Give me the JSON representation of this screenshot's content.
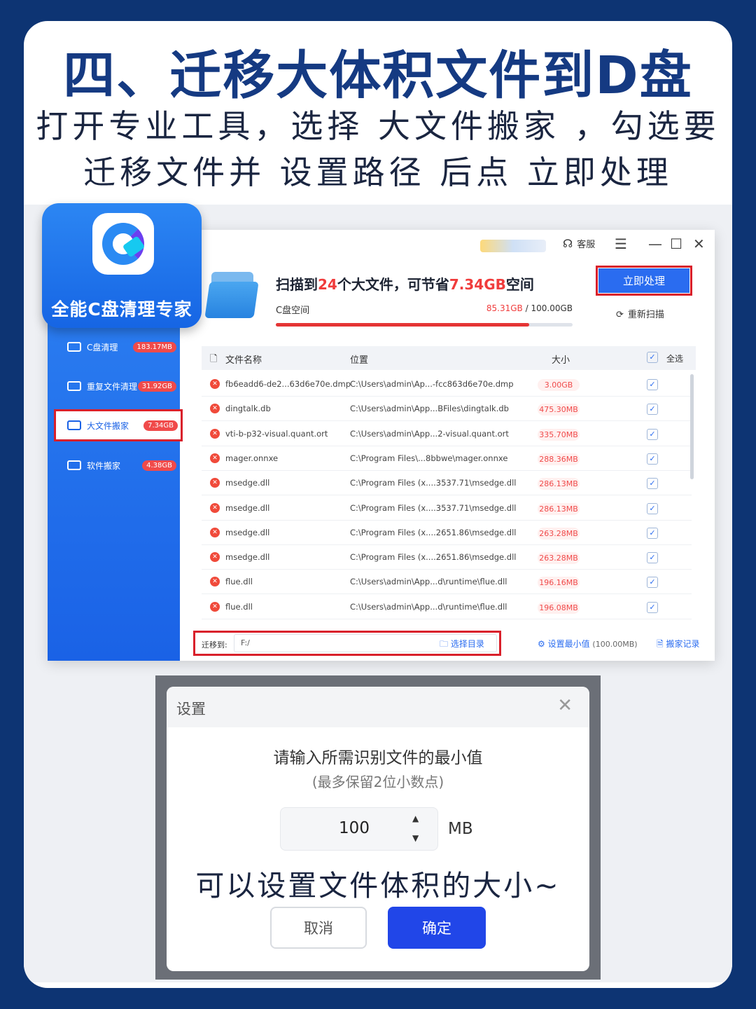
{
  "headline": "四、迁移大体积文件到D盘",
  "subtitle_line1": "打开专业工具，选择 大文件搬家 ，勾选要",
  "subtitle_line2": "迁移文件并 设置路径 后点 立即处理",
  "app": {
    "name": "全能C盘清理专家",
    "topbar": {
      "service": "客服"
    },
    "sidebar": [
      {
        "label": "C盘清理",
        "badge": "183.17MB",
        "icon": "disk-icon"
      },
      {
        "label": "重复文件清理",
        "badge": "31.92GB",
        "icon": "duplicate-icon"
      },
      {
        "label": "大文件搬家",
        "badge": "7.34GB",
        "icon": "folder-icon",
        "active": true
      },
      {
        "label": "软件搬家",
        "badge": "4.38GB",
        "icon": "box-icon"
      }
    ],
    "scan": {
      "prefix": "扫描到",
      "count": "24",
      "mid": "个大文件，可节省",
      "savings": "7.34GB",
      "suffix": "空间",
      "disk_label": "C盘空间",
      "used": "85.31GB",
      "total": " / 100.00GB",
      "used_fraction": 0.853
    },
    "actions": {
      "process": "立即处理",
      "rescan": "重新扫描"
    },
    "table": {
      "headers": {
        "name": "文件名称",
        "location": "位置",
        "size": "大小",
        "select_all": "全选"
      },
      "rows": [
        {
          "name": "fb6eadd6-de2...63d6e70e.dmp",
          "location": "C:\\Users\\admin\\Ap...-fcc863d6e70e.dmp",
          "size": "3.00GB"
        },
        {
          "name": "dingtalk.db",
          "location": "C:\\Users\\admin\\App...BFiles\\dingtalk.db",
          "size": "475.30MB"
        },
        {
          "name": "vti-b-p32-visual.quant.ort",
          "location": "C:\\Users\\admin\\App...2-visual.quant.ort",
          "size": "335.70MB"
        },
        {
          "name": "mager.onnxe",
          "location": "C:\\Program Files\\...8bbwe\\mager.onnxe",
          "size": "288.36MB"
        },
        {
          "name": "msedge.dll",
          "location": "C:\\Program Files (x....3537.71\\msedge.dll",
          "size": "286.13MB"
        },
        {
          "name": "msedge.dll",
          "location": "C:\\Program Files (x....3537.71\\msedge.dll",
          "size": "286.13MB"
        },
        {
          "name": "msedge.dll",
          "location": "C:\\Program Files (x....2651.86\\msedge.dll",
          "size": "263.28MB"
        },
        {
          "name": "msedge.dll",
          "location": "C:\\Program Files (x....2651.86\\msedge.dll",
          "size": "263.28MB"
        },
        {
          "name": "flue.dll",
          "location": "C:\\Users\\admin\\App...d\\runtime\\flue.dll",
          "size": "196.16MB"
        },
        {
          "name": "flue.dll",
          "location": "C:\\Users\\admin\\App...d\\runtime\\flue.dll",
          "size": "196.08MB"
        }
      ]
    },
    "bottom": {
      "move_to_label": "迁移到:",
      "path": "F:/",
      "choose_dir": "选择目录",
      "set_min": "设置最小值",
      "min_value": "(100.00MB)",
      "record": "搬家记录"
    }
  },
  "dialog": {
    "title": "设置",
    "question": "请输入所需识别文件的最小值",
    "hint": "(最多保留2位小数点)",
    "value": "100",
    "unit": "MB",
    "note": "可以设置文件体积的大小~",
    "cancel": "取消",
    "confirm": "确定"
  },
  "colors": {
    "accent": "#2a6cf0",
    "highlight": "#f03c3c",
    "frame": "#d9202b",
    "background": "#0d3473"
  }
}
